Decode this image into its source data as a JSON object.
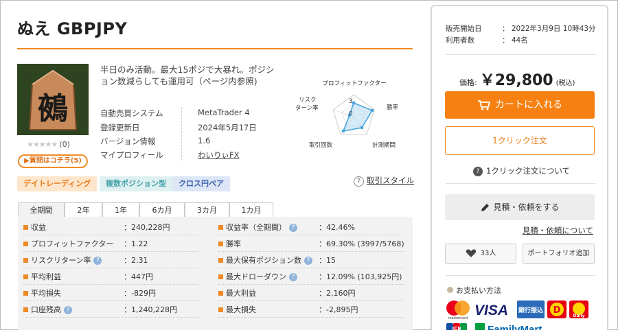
{
  "product": {
    "title": "ぬえ GBPJPY",
    "image_char": "鵺",
    "rating_stars": "★★★★★",
    "rating_count": "(0)",
    "question_button": "▶質問はコチラ(5)",
    "description": "半日のみ活動。最大15ポジで大暴れ。ポジション数減らしても運用可（ページ内参照)",
    "info": [
      {
        "label": "自動売買システム",
        "value": "MetaTrader 4"
      },
      {
        "label": "登録更新日",
        "value": "2024年5月17日"
      },
      {
        "label": "バージョン情報",
        "value": "1.6"
      },
      {
        "label": "マイプロフィール",
        "value": "わいりぃFX"
      }
    ]
  },
  "radar": {
    "labels": [
      "プロフィットファクター",
      "勝率",
      "計測期間",
      "取引回数",
      "リスク\nターン率"
    ],
    "scale": [
      3,
      0
    ]
  },
  "tags": [
    "デイトレーディング",
    "複数ポジション型",
    "クロス円ペア"
  ],
  "style_link": {
    "icon": "?",
    "label": "取引スタイル"
  },
  "tabs": [
    "全期間",
    "2年",
    "1年",
    "6カ月",
    "3カ月",
    "1カ月"
  ],
  "stats_left": [
    {
      "label": "収益",
      "value": "：240,228円",
      "help": false
    },
    {
      "label": "プロフィットファクター",
      "value": "：1.22",
      "help": false
    },
    {
      "label": "リスクリターン率",
      "value": "：2.31",
      "help": true
    },
    {
      "label": "平均利益",
      "value": "：447円",
      "help": false
    },
    {
      "label": "平均損失",
      "value": "：-829円",
      "help": false
    },
    {
      "label": "口座残高",
      "value": "：1,240,228円",
      "help": true
    }
  ],
  "stats_right": [
    {
      "label": "収益率（全期間）",
      "value": "：42.46%",
      "help": true
    },
    {
      "label": "勝率",
      "value": "：69.30% (3997/5768)",
      "help": false
    },
    {
      "label": "最大保有ポジション数",
      "value": "：15",
      "help": true
    },
    {
      "label": "最大ドローダウン",
      "value": "：12.09% (103,925円)",
      "help": true
    },
    {
      "label": "最大利益",
      "value": "：2,160円",
      "help": false
    },
    {
      "label": "最大損失",
      "value": "：-2,895円",
      "help": false
    }
  ],
  "sidebar": {
    "release_label": "販売開始日",
    "release_value": "：  2022年3月9日 10時43分",
    "users_label": "利用者数",
    "users_value": "：  44名",
    "price_label": "価格:",
    "price_value": "￥29,800",
    "tax_label": "(税込)",
    "cart_button": "カートに入れる",
    "oneclick_button": "1クリック注文",
    "oneclick_about": "1クリック注文について",
    "estimate_button": "見積・依頼をする",
    "estimate_about": "見積・依頼について",
    "favorites": "33人",
    "portfolio_button": "ポートフォリオ追加",
    "payment_title": "お支払い方法",
    "payment_logos": [
      "mastercard",
      "VISA",
      "銀行振込",
      "D",
      "Daily",
      "JCB",
      "FamilyMart"
    ]
  },
  "colors": {
    "accent": "#f08a24",
    "cart": "#f68112",
    "panel": "#f2f2f2"
  }
}
